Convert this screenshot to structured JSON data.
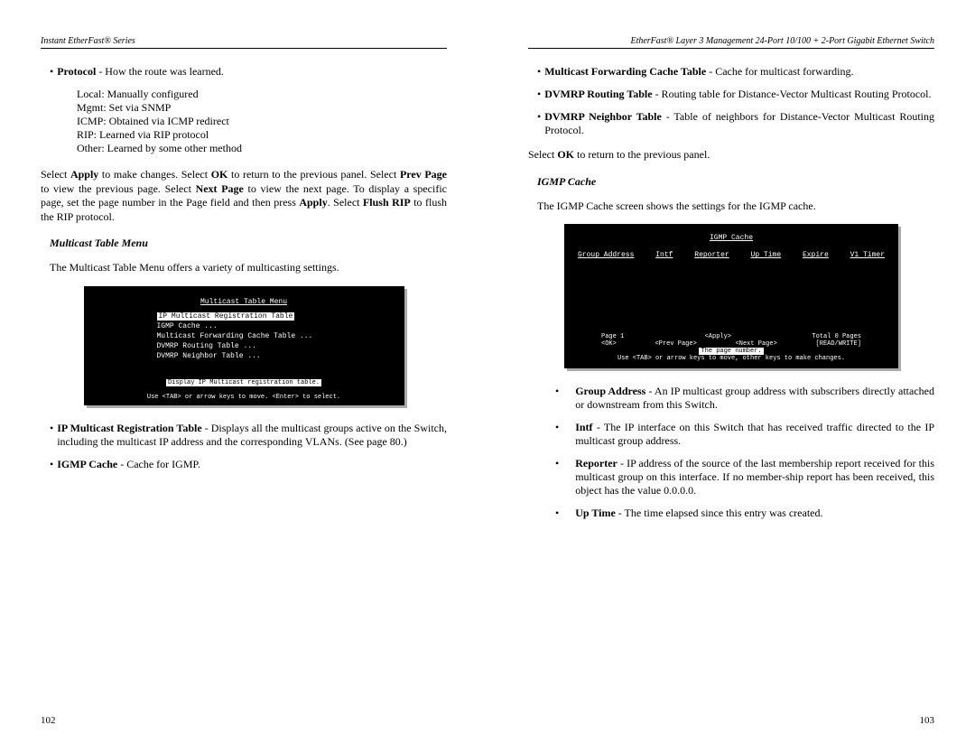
{
  "leftPage": {
    "header": "Instant EtherFast® Series",
    "pageNum": "102",
    "protocol_item": "<b>Protocol</b> - How the route was learned.",
    "protocol_lines": [
      "Local: Manually configured",
      "Mgmt: Set via SNMP",
      "ICMP: Obtained via ICMP redirect",
      "RIP: Learned via RIP protocol",
      "Other: Learned by some other method"
    ],
    "para1": "Select <b>Apply</b> to make changes. Select <b>OK</b> to return to the previous panel. Select <b>Prev Page</b> to view the previous page. Select <b>Next Page</b> to view the next page. To display a specific page, set the page number in the Page field and then press <b>Apply</b>. Select <b>Flush RIP</b> to flush the RIP protocol.",
    "subheading": "Multicast Table Menu",
    "para2": "The Multicast Table Menu offers a variety of multicasting settings.",
    "terminal": {
      "title": "Multicast Table Menu",
      "items": [
        "IP Multicast Registration Table",
        "IGMP Cache ...",
        "Multicast Forwarding Cache Table ...",
        "DVMRP Routing Table ...",
        "DVMRP Neighbor Table ..."
      ],
      "footer1": "Display IP Multicast registration table.",
      "footer2": "Use <TAB> or arrow keys to move. <Enter> to select."
    },
    "bullets": [
      "<b>IP Multicast Registration Table</b> - Displays all the multicast groups active on the Switch, including the multicast IP address and the corresponding VLANs. (See page 80.)",
      "<b>IGMP Cache</b> - Cache for IGMP."
    ]
  },
  "rightPage": {
    "header": "EtherFast® Layer 3 Management 24-Port 10/100 + 2-Port Gigabit Ethernet Switch",
    "pageNum": "103",
    "topBullets": [
      "<b>Multicast Forwarding Cache Table</b> - Cache for multicast forwarding.",
      "<b>DVMRP Routing Table</b> - Routing table for Distance-Vector Multicast Routing Protocol.",
      "<b>DVMRP Neighbor Table</b> - Table of neighbors for Distance-Vector Multicast Routing Protocol."
    ],
    "para1": "Select <b>OK</b> to return to the previous panel.",
    "subheading": "IGMP Cache",
    "para2": "The IGMP Cache screen shows the settings for the IGMP cache.",
    "terminal": {
      "title": "IGMP Cache",
      "cols": [
        "Group Address",
        "Intf",
        "Reporter",
        "Up Time",
        "Expire",
        "V1 Timer"
      ],
      "nav": {
        "page": "Page 1",
        "apply": "<Apply>",
        "total": "Total 0 Pages",
        "ok": "<OK>",
        "prev": "<Prev Page>",
        "pagenum": "The page number.",
        "next": "<Next Page>",
        "abort": "[READ/WRITE]"
      },
      "footer": "Use <TAB> or arrow keys to move, other keys to make changes."
    },
    "bottomBullets": [
      "<b>Group Address</b> - An IP multicast group address with subscribers directly attached or downstream from this Switch.",
      "<b>Intf</b> - The IP interface on this Switch that has received traffic directed to the IP multicast group address.",
      "<b>Reporter</b> - IP address of the source of the last membership report received for this multicast group on this interface. If no member-ship report has been received, this object has the value 0.0.0.0.",
      "<b>Up Time</b> - The time elapsed since this entry was created."
    ]
  }
}
